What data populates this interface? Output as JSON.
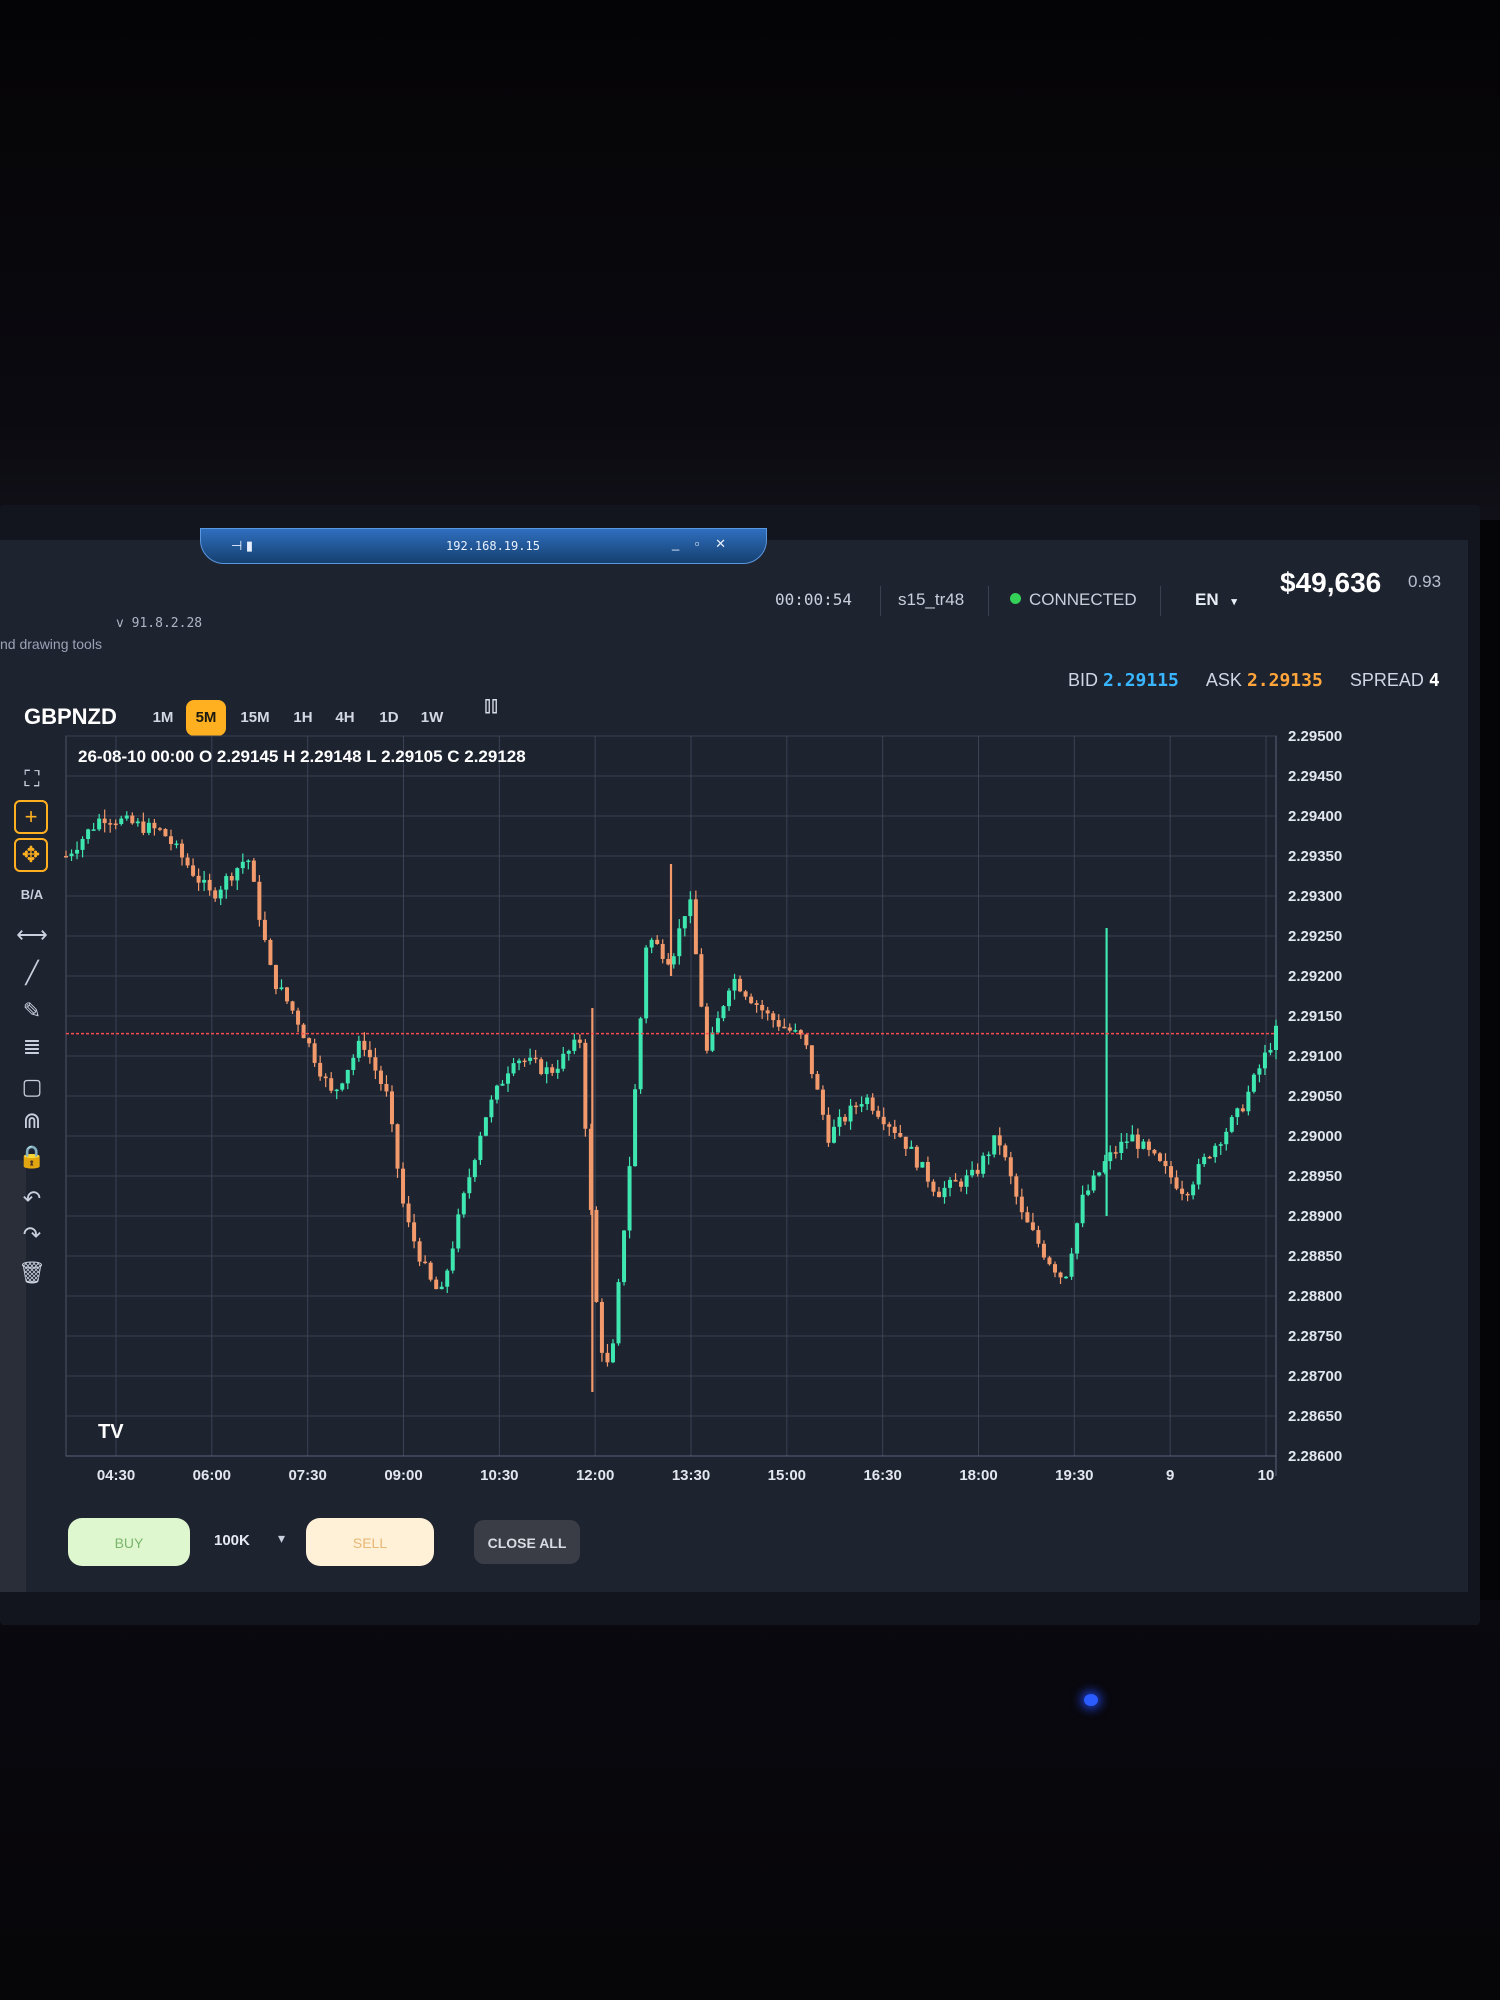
{
  "remote": {
    "ip": "192.168.19.15",
    "pin_icon": "pin-icon",
    "controls": "_ ▫ ✕"
  },
  "app": {
    "version": "v 91.8.2.28",
    "hint": "nd drawing tools"
  },
  "status": {
    "timer": "00:00:54",
    "user": "s15_tr48",
    "connection": "CONNECTED",
    "language": "EN",
    "balance": "$49,636",
    "leverage": "0.93"
  },
  "quotes": {
    "bid_label": "BID",
    "bid": "2.29115",
    "ask_label": "ASK",
    "ask": "2.29135",
    "spread_label": "SPREAD",
    "spread": "4"
  },
  "symbol": "GBPNZD",
  "timeframes": [
    {
      "label": "1M",
      "active": false
    },
    {
      "label": "5M",
      "active": true
    },
    {
      "label": "15M",
      "active": false
    },
    {
      "label": "1H",
      "active": false
    },
    {
      "label": "4H",
      "active": false
    },
    {
      "label": "1D",
      "active": false
    },
    {
      "label": "1W",
      "active": false
    }
  ],
  "tools": [
    {
      "name": "fullscreen-icon",
      "glyph": "⛶"
    },
    {
      "name": "crosshair-icon",
      "glyph": "+"
    },
    {
      "name": "move-icon",
      "glyph": "✥"
    },
    {
      "name": "bid-ask-toggle",
      "glyph": "B/A"
    },
    {
      "name": "horizontal-line-icon",
      "glyph": "⟷"
    },
    {
      "name": "trend-line-icon",
      "glyph": "╱"
    },
    {
      "name": "brush-icon",
      "glyph": "✎"
    },
    {
      "name": "fib-icon",
      "glyph": "≣"
    },
    {
      "name": "rectangle-icon",
      "glyph": "▢"
    },
    {
      "name": "magnet-icon",
      "glyph": "⋒"
    },
    {
      "name": "lock-icon",
      "glyph": "🔒"
    },
    {
      "name": "undo-icon",
      "glyph": "↶"
    },
    {
      "name": "redo-icon",
      "glyph": "↷"
    },
    {
      "name": "trash-icon",
      "glyph": "🗑"
    }
  ],
  "trade": {
    "buy": "BUY",
    "lot": "100K",
    "sell": "SELL",
    "close_all": "CLOSE ALL"
  },
  "colors": {
    "up": "#3ee6b0",
    "down": "#f39a6c",
    "grid": "#3a4254",
    "bg": "#1e2330",
    "accent": "#ffb020",
    "current_line": "#ff4d4d"
  },
  "chart_data": {
    "type": "candlestick",
    "ohlc_label": "26-08-10 00:00 O 2.29145 H 2.29148 L 2.29105 C 2.29128",
    "current_price": 2.29128,
    "y_ticks": [
      "2.29500",
      "2.29450",
      "2.29400",
      "2.29350",
      "2.29300",
      "2.29250",
      "2.29200",
      "2.29150",
      "2.29100",
      "2.29050",
      "2.29000",
      "2.28950",
      "2.28900",
      "2.28850",
      "2.28800",
      "2.28750",
      "2.28700",
      "2.28650",
      "2.28600"
    ],
    "ylim": [
      2.286,
      2.295
    ],
    "x_ticks": [
      "04:30",
      "06:00",
      "07:30",
      "09:00",
      "10:30",
      "12:00",
      "13:30",
      "15:00",
      "16:30",
      "18:00",
      "19:30",
      "9",
      "10"
    ],
    "watermark": "TV",
    "price_path": [
      [
        0,
        2.2935
      ],
      [
        0.03,
        2.294
      ],
      [
        0.08,
        2.2938
      ],
      [
        0.12,
        2.293
      ],
      [
        0.15,
        2.2935
      ],
      [
        0.17,
        2.292
      ],
      [
        0.19,
        2.2915
      ],
      [
        0.22,
        2.2905
      ],
      [
        0.245,
        2.2912
      ],
      [
        0.265,
        2.2905
      ],
      [
        0.28,
        2.289
      ],
      [
        0.3,
        2.2882
      ],
      [
        0.31,
        2.288
      ],
      [
        0.325,
        2.289
      ],
      [
        0.345,
        2.2902
      ],
      [
        0.37,
        2.291
      ],
      [
        0.4,
        2.2908
      ],
      [
        0.425,
        2.2912
      ],
      [
        0.44,
        2.2875
      ],
      [
        0.45,
        2.287
      ],
      [
        0.465,
        2.2895
      ],
      [
        0.48,
        2.2925
      ],
      [
        0.5,
        2.2922
      ],
      [
        0.515,
        2.293
      ],
      [
        0.53,
        2.291
      ],
      [
        0.55,
        2.292
      ],
      [
        0.58,
        2.2915
      ],
      [
        0.61,
        2.2912
      ],
      [
        0.63,
        2.29
      ],
      [
        0.66,
        2.2905
      ],
      [
        0.69,
        2.29
      ],
      [
        0.72,
        2.2893
      ],
      [
        0.75,
        2.2895
      ],
      [
        0.77,
        2.29
      ],
      [
        0.79,
        2.289
      ],
      [
        0.81,
        2.2885
      ],
      [
        0.825,
        2.2882
      ],
      [
        0.84,
        2.2892
      ],
      [
        0.86,
        2.2897
      ],
      [
        0.88,
        2.29
      ],
      [
        0.9,
        2.2897
      ],
      [
        0.925,
        2.2893
      ],
      [
        0.945,
        2.2898
      ],
      [
        0.97,
        2.2903
      ],
      [
        1.0,
        2.2913
      ]
    ],
    "spikes": [
      {
        "t": 0.435,
        "high": 2.2916,
        "low": 2.2868,
        "dir": "down"
      },
      {
        "t": 0.5,
        "high": 2.2934,
        "low": 2.292,
        "dir": "down"
      },
      {
        "t": 0.86,
        "high": 2.2926,
        "low": 2.289,
        "dir": "up"
      }
    ]
  }
}
